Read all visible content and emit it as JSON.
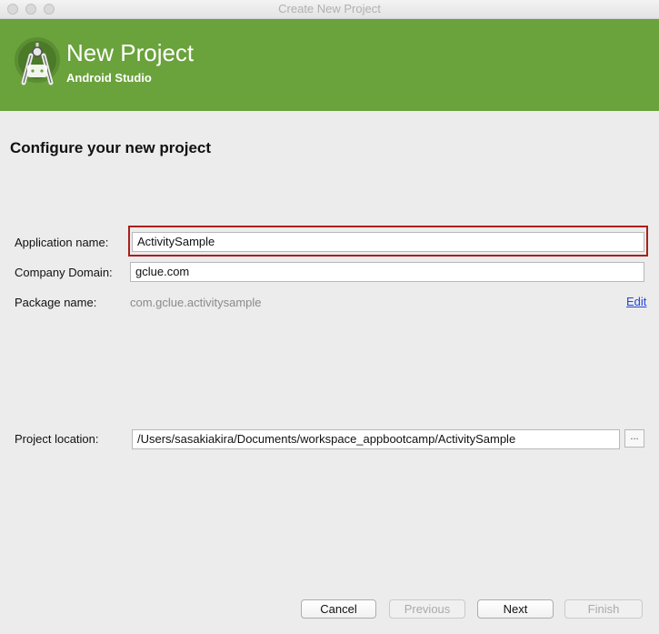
{
  "window": {
    "title": "Create New Project"
  },
  "banner": {
    "title": "New Project",
    "subtitle": "Android Studio",
    "color": "#6aa23c",
    "logo_icon": "android-studio-logo-icon"
  },
  "page": {
    "heading": "Configure your new project"
  },
  "form": {
    "app_name_label": "Application name:",
    "app_name_value": "ActivitySample",
    "company_domain_label": "Company Domain:",
    "company_domain_value": "gclue.com",
    "package_name_label": "Package name:",
    "package_name_value": "com.gclue.activitysample",
    "edit_link": "Edit",
    "project_location_label": "Project location:",
    "project_location_value": "/Users/sasakiakira/Documents/workspace_appbootcamp/ActivitySample",
    "browse_label": "..."
  },
  "buttons": {
    "cancel": "Cancel",
    "previous": "Previous",
    "next": "Next",
    "finish": "Finish"
  },
  "colors": {
    "highlight_border": "#a9201d",
    "link": "#2346d6"
  }
}
